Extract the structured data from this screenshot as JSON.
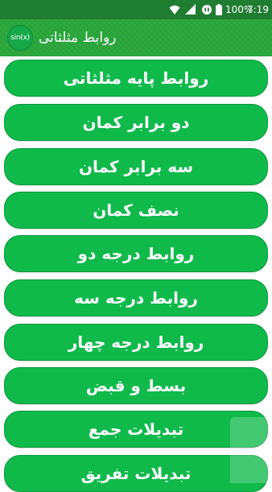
{
  "status_bar": {
    "battery": "100%",
    "time": "7:19"
  },
  "app_bar": {
    "logo_text": "sin(x)",
    "title": "روابط مثلثاتی"
  },
  "menu": [
    {
      "label": "روابط پایه مثلثاتی"
    },
    {
      "label": "دو برابر کمان"
    },
    {
      "label": "سه برابر کمان"
    },
    {
      "label": "نصف کمان"
    },
    {
      "label": "روابط درجه دو"
    },
    {
      "label": "روابط درجه سه"
    },
    {
      "label": "روابط درجه چهار"
    },
    {
      "label": "بسط و قبض"
    },
    {
      "label": "تبدیلات جمع"
    },
    {
      "label": "تبدیلات تفریق"
    }
  ],
  "colors": {
    "status_bar": "#1f7d31",
    "app_bar": "#2aa63b",
    "button": "#0fba4b"
  },
  "icons": {
    "network": "wifi-icon",
    "signal": "cellular-signal-icon",
    "data_saver": "data-saver-icon",
    "battery": "battery-icon"
  }
}
